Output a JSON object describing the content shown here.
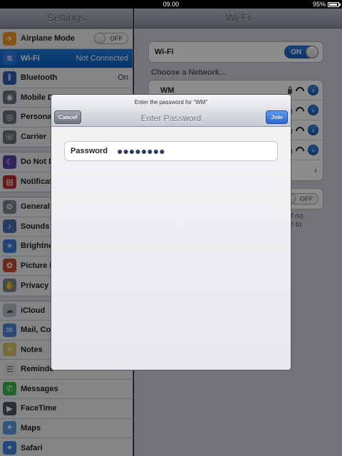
{
  "status_bar": {
    "time": "09.00",
    "battery": "95%",
    "battery_fill": 0.95
  },
  "sidebar": {
    "title": "Settings",
    "groups": [
      [
        {
          "label": "Airplane Mode",
          "icon": "airplane-icon",
          "color": "#f29a1a",
          "toggle": "OFF"
        },
        {
          "label": "Wi-Fi",
          "icon": "wifi-icon",
          "color": "#2c7be5",
          "value": "Not Connected",
          "selected": true
        },
        {
          "label": "Bluetooth",
          "icon": "bluetooth-icon",
          "color": "#2f5fb4",
          "value": "On"
        },
        {
          "label": "Mobile D",
          "icon": "mobile-data-icon",
          "color": "#6a717b"
        },
        {
          "label": "Persona",
          "icon": "personal-hotspot-icon",
          "color": "#6a717b"
        },
        {
          "label": "Carrier",
          "icon": "carrier-icon",
          "color": "#6a717b"
        }
      ],
      [
        {
          "label": "Do Not D",
          "icon": "moon-icon",
          "color": "#5a3fa6"
        },
        {
          "label": "Notificat",
          "icon": "notifications-icon",
          "color": "#bf2f2f"
        }
      ],
      [
        {
          "label": "General",
          "icon": "gear-icon",
          "color": "#7e858f"
        },
        {
          "label": "Sounds",
          "icon": "speaker-icon",
          "color": "#4a6db3"
        },
        {
          "label": "Brightne",
          "icon": "brightness-icon",
          "color": "#3d7fd8"
        },
        {
          "label": "Picture F",
          "icon": "picture-frame-icon",
          "color": "#c64a2d"
        },
        {
          "label": "Privacy",
          "icon": "hand-icon",
          "color": "#7e858f"
        }
      ],
      [
        {
          "label": "iCloud",
          "icon": "cloud-icon",
          "color": "#b6bcc4"
        },
        {
          "label": "Mail, Co",
          "icon": "mail-icon",
          "color": "#4f86d6"
        },
        {
          "label": "Notes",
          "icon": "notes-icon",
          "color": "#d9c36a"
        },
        {
          "label": "Reminde",
          "icon": "reminders-icon",
          "color": "#e8e8e8"
        },
        {
          "label": "Messages",
          "icon": "messages-icon",
          "color": "#39b54a"
        },
        {
          "label": "FaceTime",
          "icon": "facetime-icon",
          "color": "#4d5563"
        },
        {
          "label": "Maps",
          "icon": "maps-icon",
          "color": "#5a9be0"
        },
        {
          "label": "Safari",
          "icon": "safari-icon",
          "color": "#3f86e0"
        }
      ]
    ]
  },
  "detail": {
    "title": "Wi-Fi",
    "wifi_label": "Wi-Fi",
    "wifi_toggle": "ON",
    "choose_network": "Choose a Network...",
    "network_name": "WM",
    "ask_toggle": "OFF",
    "desc_line1": "y. If no",
    "desc_line2": "ave to"
  },
  "modal": {
    "prompt": "Enter the password for “WM”",
    "title": "Enter Password",
    "cancel_label": "Cancel",
    "join_label": "Join",
    "password_label": "Password",
    "password_value": "●●●●●●●●"
  }
}
